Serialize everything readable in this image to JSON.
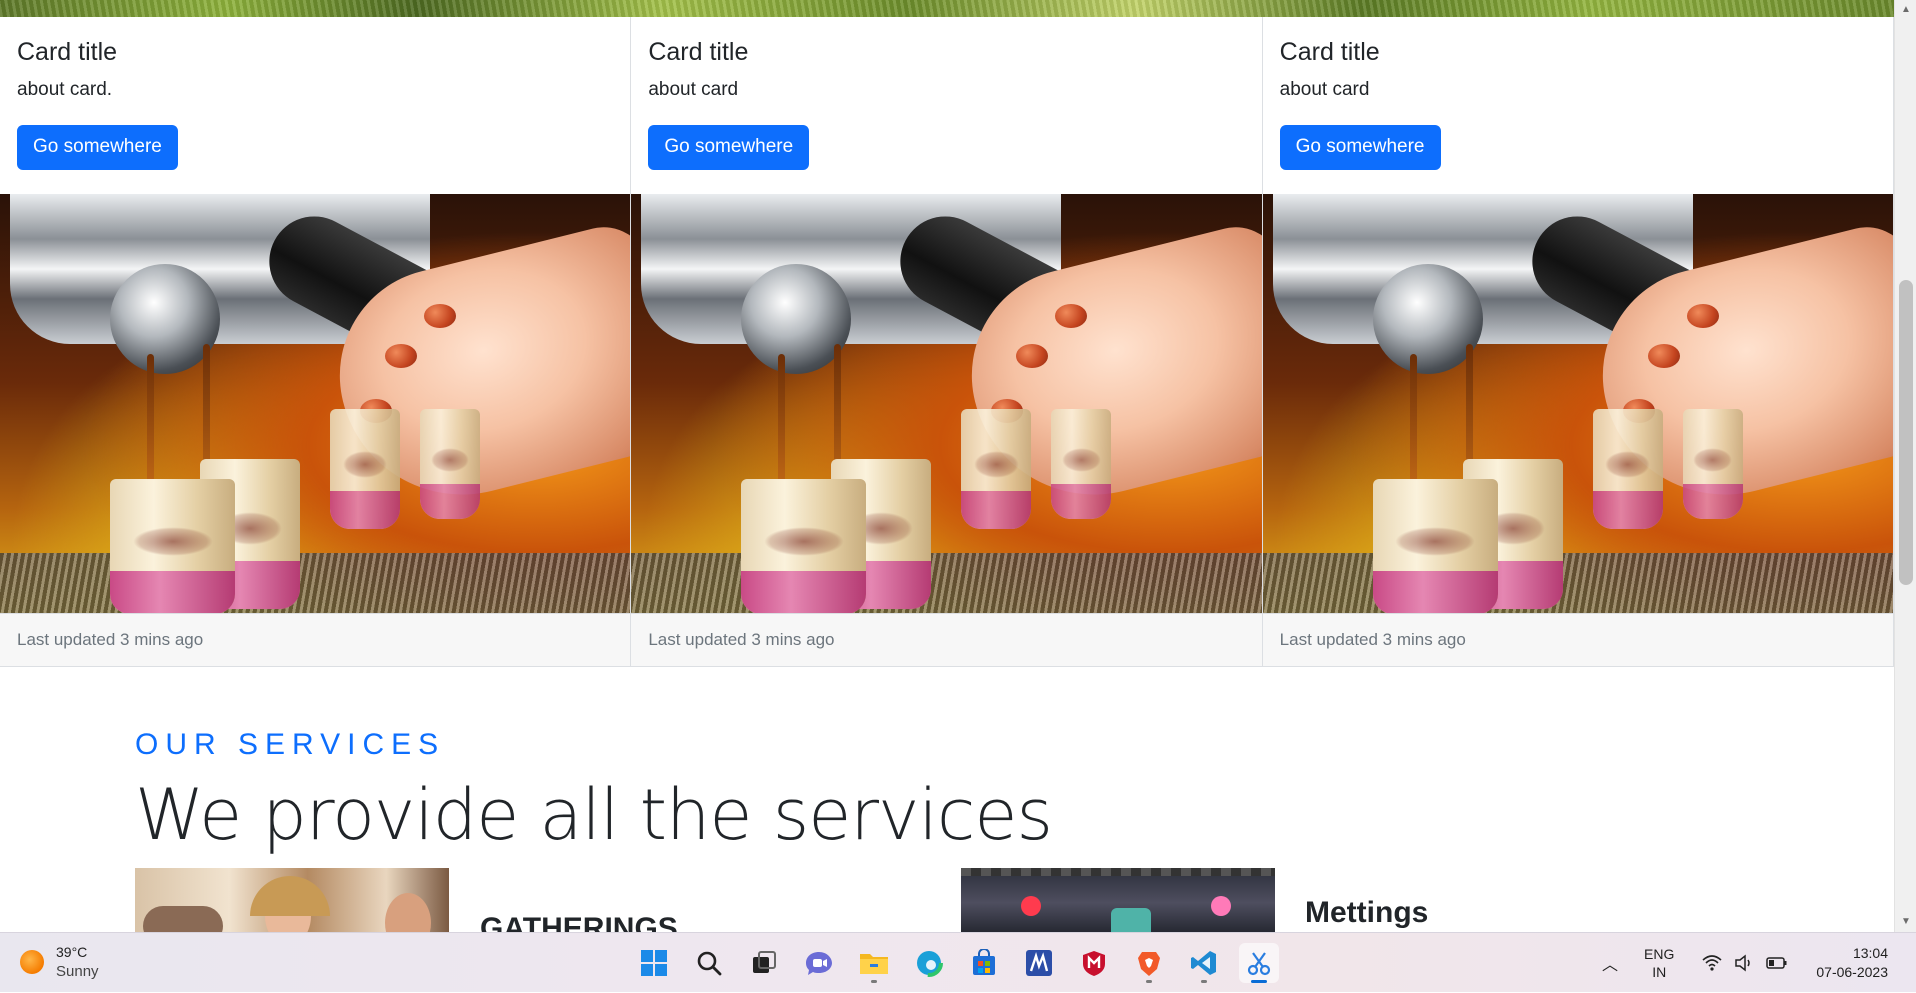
{
  "cards": [
    {
      "title": "Card title",
      "text": "about card.",
      "button": "Go somewhere",
      "footer": "Last updated 3 mins ago"
    },
    {
      "title": "Card title",
      "text": "about card",
      "button": "Go somewhere",
      "footer": "Last updated 3 mins ago"
    },
    {
      "title": "Card title",
      "text": "about card",
      "button": "Go somewhere",
      "footer": "Last updated 3 mins ago"
    }
  ],
  "services": {
    "eyebrow": "OUR SERVICES",
    "headline": "We provide all the services",
    "items": [
      {
        "title": "GATHERINGS"
      },
      {
        "title": "Mettings"
      }
    ]
  },
  "taskbar": {
    "weather": {
      "temp": "39°C",
      "condition": "Sunny"
    },
    "apps": [
      "start-icon",
      "search-icon",
      "task-view-icon",
      "chat-icon",
      "file-explorer-icon",
      "edge-icon",
      "store-icon",
      "app-m-icon",
      "mcafee-icon",
      "brave-icon",
      "vscode-icon",
      "snipping-tool-icon"
    ],
    "language": {
      "line1": "ENG",
      "line2": "IN"
    },
    "clock": {
      "time": "13:04",
      "date": "07-06-2023"
    }
  },
  "colors": {
    "primary": "#0d6efd",
    "footer_bg": "#f7f7f7",
    "muted": "#6c757d"
  }
}
